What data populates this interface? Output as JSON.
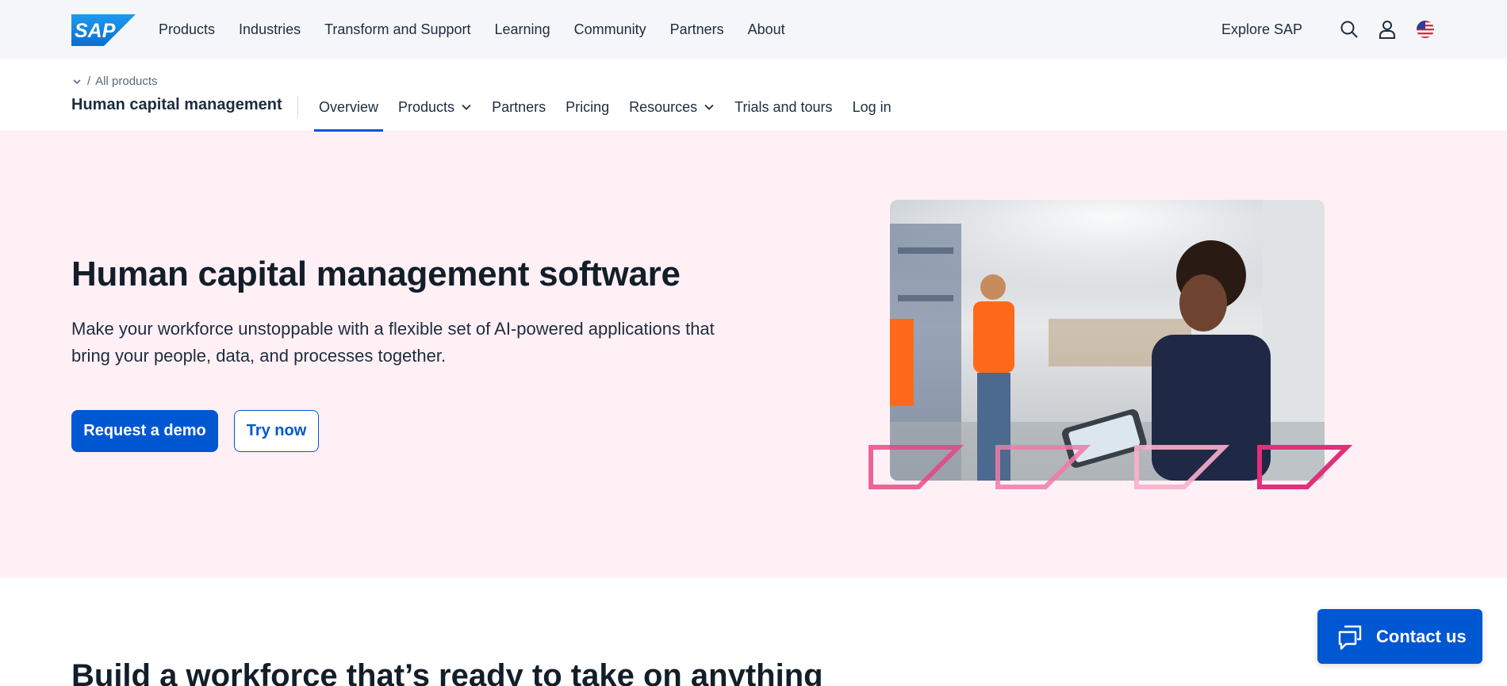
{
  "global_nav": {
    "logo_text": "SAP",
    "links": [
      "Products",
      "Industries",
      "Transform and Support",
      "Learning",
      "Community",
      "Partners",
      "About"
    ],
    "explore_label": "Explore SAP",
    "icons": [
      "search-icon",
      "user-icon",
      "us-flag-icon"
    ]
  },
  "sub_nav": {
    "breadcrumb_sep": "/",
    "breadcrumb_link": "All products",
    "title": "Human capital management",
    "tabs": [
      {
        "label": "Overview",
        "active": true
      },
      {
        "label": "Products",
        "dropdown": true
      },
      {
        "label": "Partners"
      },
      {
        "label": "Pricing"
      },
      {
        "label": "Resources",
        "dropdown": true
      },
      {
        "label": "Trials and tours"
      },
      {
        "label": "Log in"
      }
    ]
  },
  "hero": {
    "title": "Human capital management software",
    "subtitle": "Make your workforce unstoppable with a flexible set of AI-powered applications that bring your people, data, and processes together.",
    "primary_button": "Request a demo",
    "secondary_button": "Try now",
    "background_color": "#fff0f6",
    "accent_color": "#e8417f"
  },
  "section": {
    "title": "Build a workforce that’s ready to take on anything"
  },
  "contact": {
    "label": "Contact us"
  },
  "colors": {
    "brand_blue": "#0057d2",
    "text_dark": "#1d2d3e",
    "nav_bg": "#f5f6fa"
  }
}
